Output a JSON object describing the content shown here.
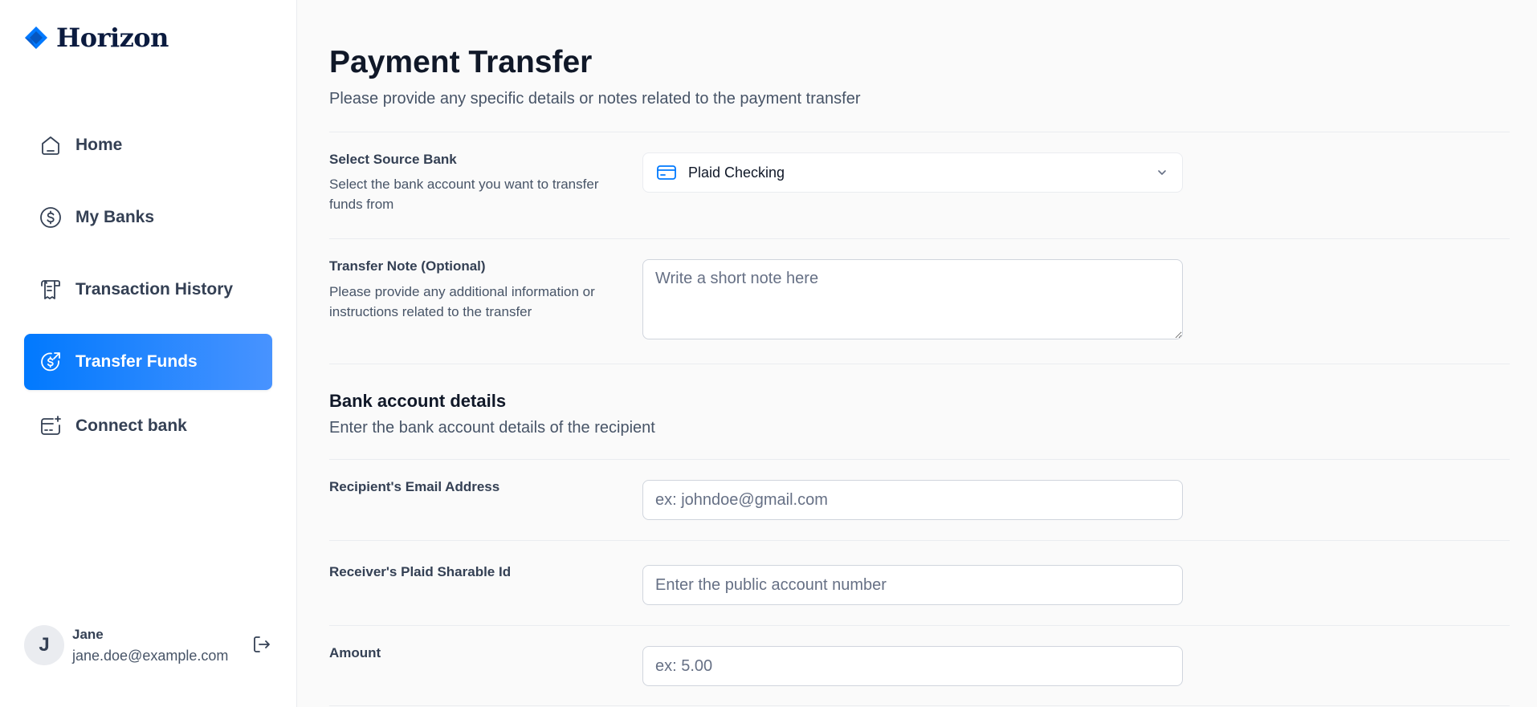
{
  "brand": {
    "name": "Horizon"
  },
  "nav": {
    "items": [
      {
        "label": "Home",
        "icon": "home-icon"
      },
      {
        "label": "My Banks",
        "icon": "dollar-circle-icon"
      },
      {
        "label": "Transaction History",
        "icon": "receipt-icon"
      },
      {
        "label": "Transfer Funds",
        "icon": "money-send-icon",
        "active": true
      },
      {
        "label": "Connect bank",
        "icon": "card-add-icon"
      }
    ]
  },
  "user": {
    "initial": "J",
    "name": "Jane",
    "email": "jane.doe@example.com"
  },
  "page": {
    "title": "Payment Transfer",
    "subtitle": "Please provide any specific details or notes related to the payment transfer"
  },
  "form": {
    "source_bank": {
      "label": "Select Source Bank",
      "description": "Select the bank account you want to transfer funds from",
      "value": "Plaid Checking"
    },
    "note": {
      "label": "Transfer Note (Optional)",
      "description": "Please provide any additional information or instructions related to the transfer",
      "placeholder": "Write a short note here"
    },
    "bank_details": {
      "title": "Bank account details",
      "subtitle": "Enter the bank account details of the recipient"
    },
    "email": {
      "label": "Recipient's Email Address",
      "placeholder": "ex: johndoe@gmail.com"
    },
    "sharable_id": {
      "label": "Receiver's Plaid Sharable Id",
      "placeholder": "Enter the public account number"
    },
    "amount": {
      "label": "Amount",
      "placeholder": "ex: 5.00"
    }
  },
  "colors": {
    "accent": "#0179FE",
    "text": "#101828",
    "muted": "#475467"
  }
}
